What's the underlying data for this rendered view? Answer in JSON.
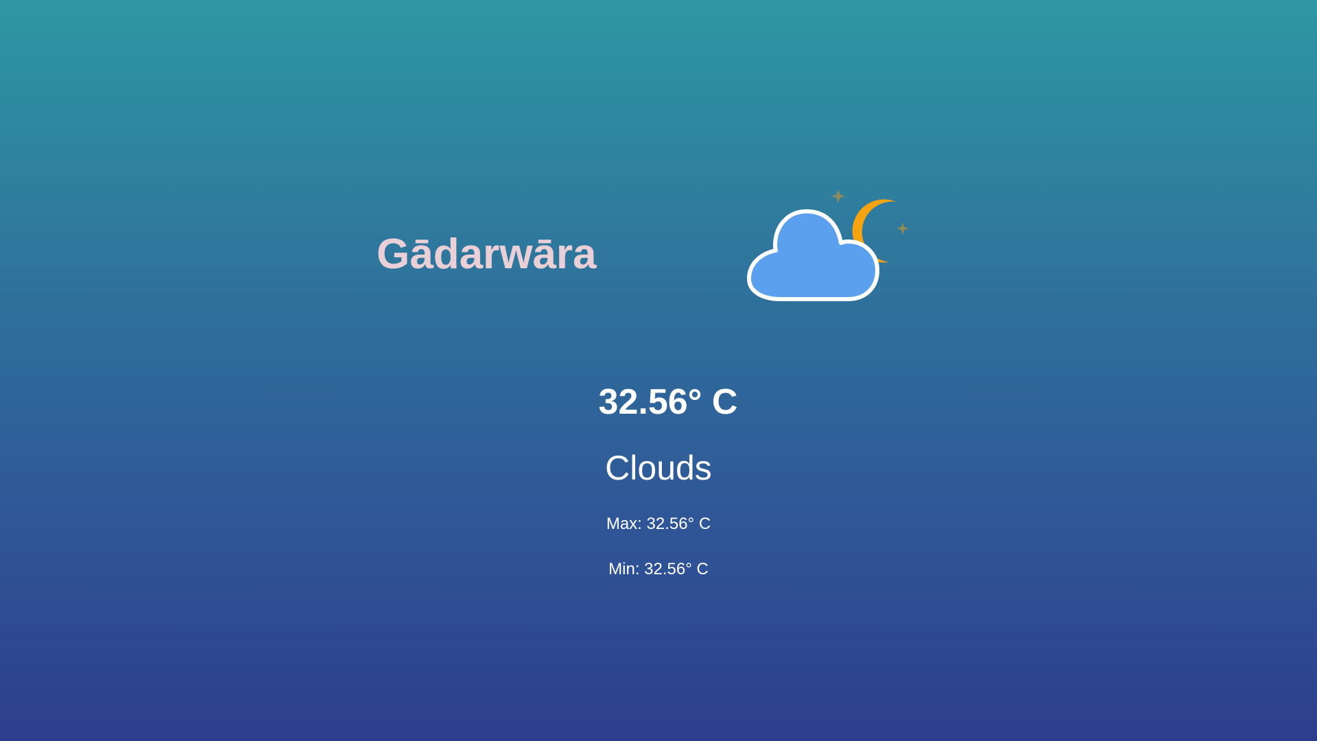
{
  "weather": {
    "city": "Gādarwāra",
    "temperature": "32.56° C",
    "condition": "Clouds",
    "max": "Max: 32.56° C",
    "min": "Min: 32.56° C",
    "icon": "cloud-moon-night-icon"
  },
  "colors": {
    "gradient_top": "#2e97a4",
    "gradient_bottom": "#2e3d8d",
    "city_text": "#e9cfd6",
    "cloud_fill": "#5aa0ee",
    "moon": "#f6a312",
    "stars": "#8d8a5c"
  }
}
